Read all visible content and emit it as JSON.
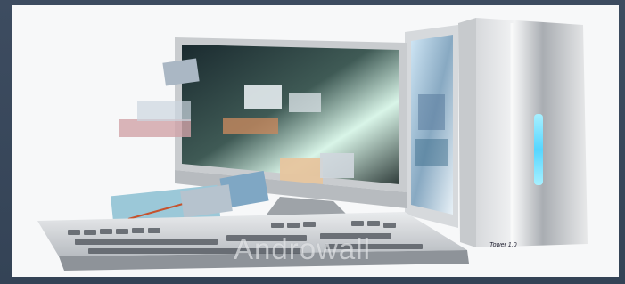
{
  "image": {
    "description_name": "desktop-computer-photo",
    "watermark_text": "Androwall",
    "tower_badge_text": "Tower 1.0",
    "accent_glow": "#56d6ff",
    "frame_color": "#3b4a5d",
    "background_color": "#f7f8f9"
  }
}
